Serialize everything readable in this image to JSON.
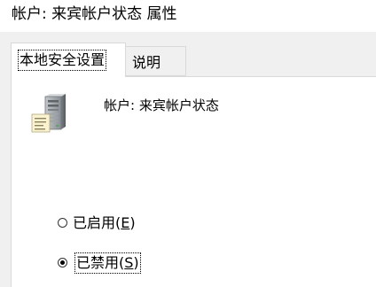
{
  "window": {
    "title": "帐户: 来宾帐户状态 属性"
  },
  "tabs": [
    {
      "label": "本地安全设置",
      "selected": true
    },
    {
      "label": "说明",
      "selected": false
    }
  ],
  "policy": {
    "icon": "server-document-icon",
    "name": "帐户: 来宾帐户状态"
  },
  "options": [
    {
      "label_prefix": "已启用(",
      "mnemonic": "E",
      "label_suffix": ")",
      "checked": false
    },
    {
      "label_prefix": "已禁用(",
      "mnemonic": "S",
      "label_suffix": ")",
      "checked": true
    }
  ]
}
